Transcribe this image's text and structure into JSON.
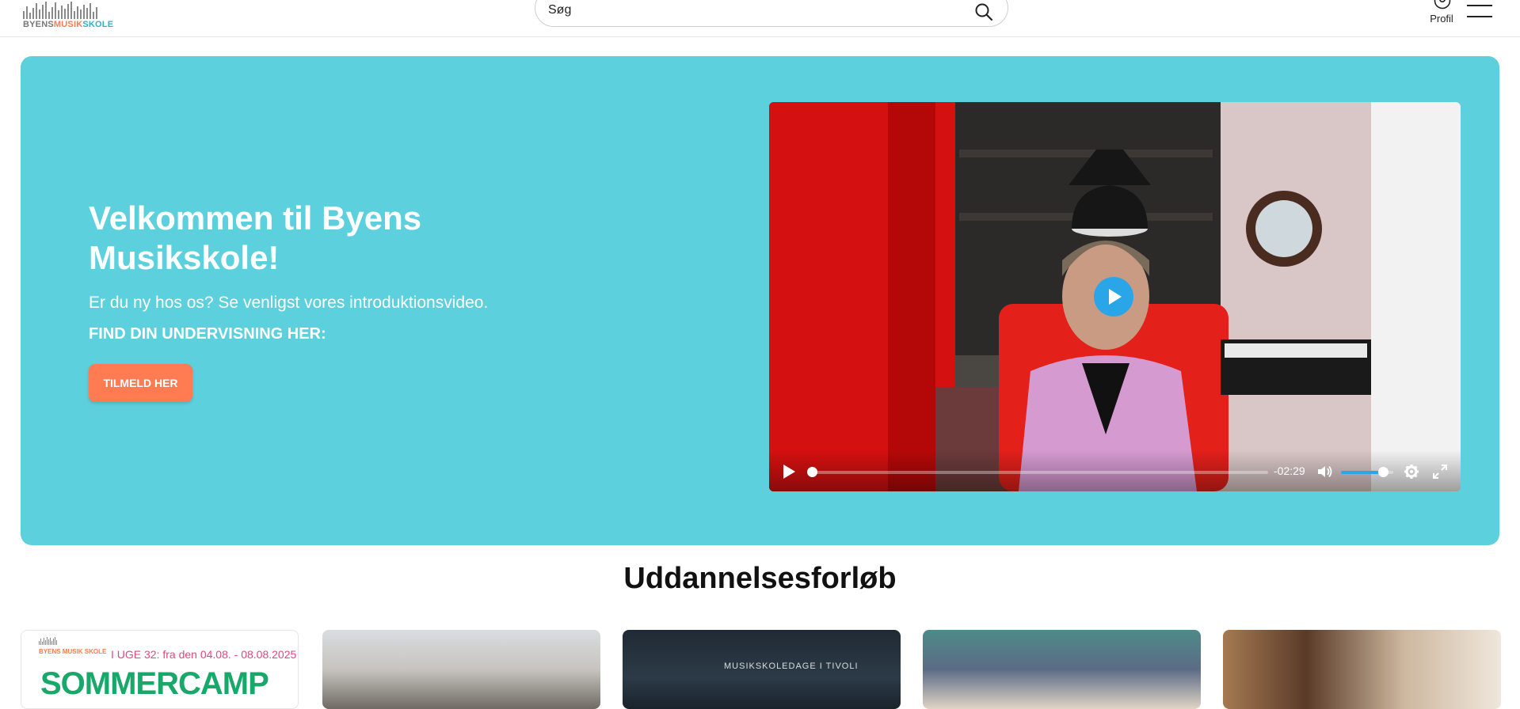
{
  "header": {
    "logo_text": {
      "byens": "BYENS",
      "musik": "MUSIK",
      "skole": "SKOLE"
    },
    "search": {
      "placeholder": "Søg",
      "icon": "search-icon"
    },
    "profile_label": "Profil",
    "menu_icon": "hamburger-icon"
  },
  "colors": {
    "hero_bg": "#5dd0dd",
    "cta": "#ff7b52",
    "accent_blue": "#2aa6e8",
    "logo_orange": "#ff7b52",
    "logo_teal": "#28b5c5"
  },
  "hero": {
    "title": "Velkommen til Byens Musikskole!",
    "intro": "Er du ny hos os? Se venligst vores introduktionsvideo.",
    "find_label": "FIND DIN UNDERVISNING HER:",
    "cta_label": "TILMELD HER"
  },
  "video": {
    "time_remaining": "-02:29",
    "progress_fraction": 0.0,
    "volume_fraction": 0.8
  },
  "section": {
    "title": "Uddannelsesforløb"
  },
  "cards": [
    {
      "logo_text": "BYENS MUSIK SKOLE",
      "dates": "I UGE 32: fra den 04.08. - 08.08.2025",
      "headline": "SOMMERCAMP"
    },
    {
      "headline": ""
    },
    {
      "stage_text": "MUSIKSKOLEDAGE I TIVOLI"
    },
    {
      "headline": ""
    },
    {
      "headline": ""
    }
  ]
}
